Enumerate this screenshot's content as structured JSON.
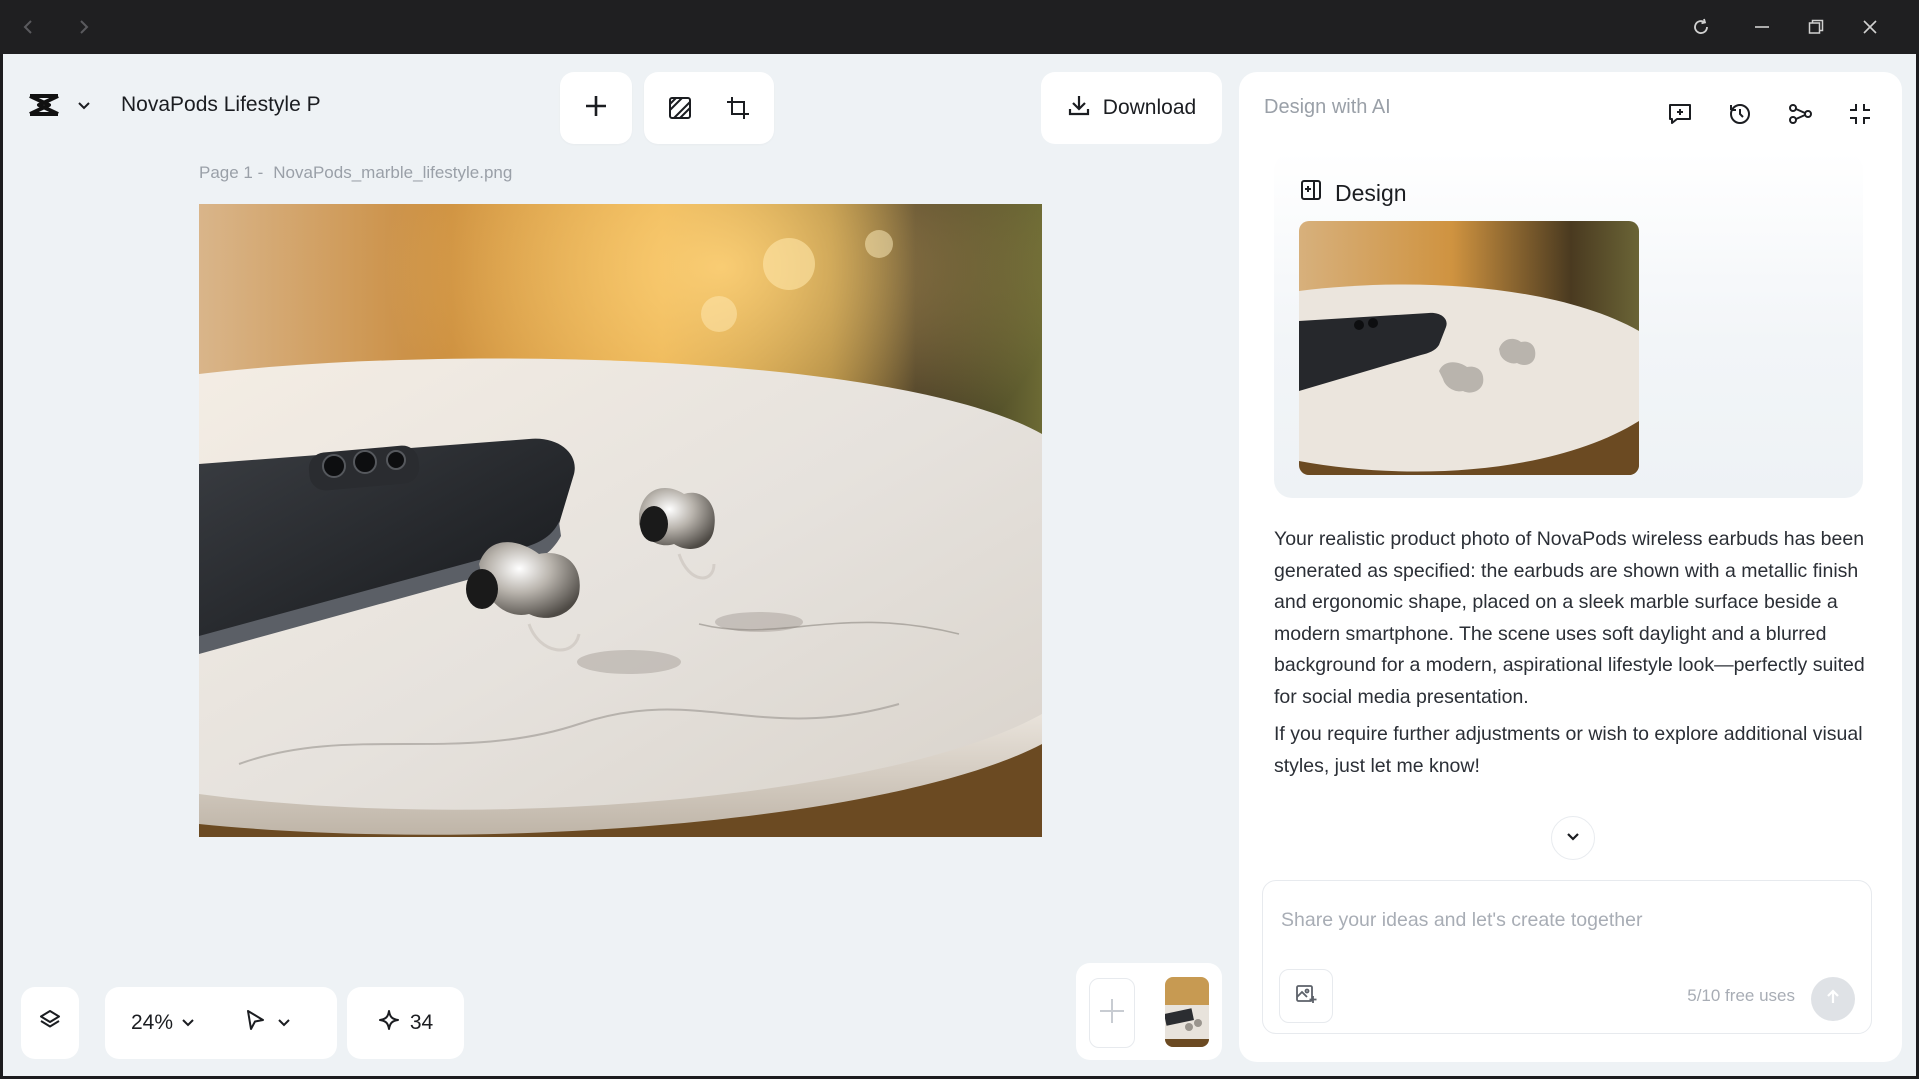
{
  "window": {
    "back_icon": "chevron-left-icon",
    "forward_icon": "chevron-right-icon",
    "reload_icon": "reload-icon",
    "minimize_icon": "minimize-icon",
    "restore_icon": "restore-icon",
    "close_icon": "close-icon"
  },
  "header": {
    "project_title": "NovaPods Lifestyle P",
    "download_label": "Download"
  },
  "canvas": {
    "page_label": "Page 1 -",
    "file_name": "NovaPods_marble_lifestyle.png"
  },
  "bottom_toolbar": {
    "zoom": "24%",
    "credits": "34"
  },
  "panel": {
    "title": "Design with AI",
    "design_card_title": "Design",
    "message_p1": "Your realistic product photo of NovaPods wireless earbuds has been generated as specified: the earbuds are shown with a metallic finish and ergonomic shape, placed on a sleek marble surface beside a modern smartphone. The scene uses soft daylight and a blurred background for a modern, aspirational lifestyle look—perfectly suited for social media presentation.",
    "message_p2": "If you require further adjustments or wish to explore additional visual styles, just let me know!",
    "input_placeholder": "Share your ideas and let's create together",
    "free_uses": "5/10 free uses"
  },
  "colors": {
    "app_bg": "#eef2f5",
    "titlebar_bg": "#1f1f21",
    "card_bg": "#ffffff",
    "muted_text": "#9aa0a8"
  }
}
